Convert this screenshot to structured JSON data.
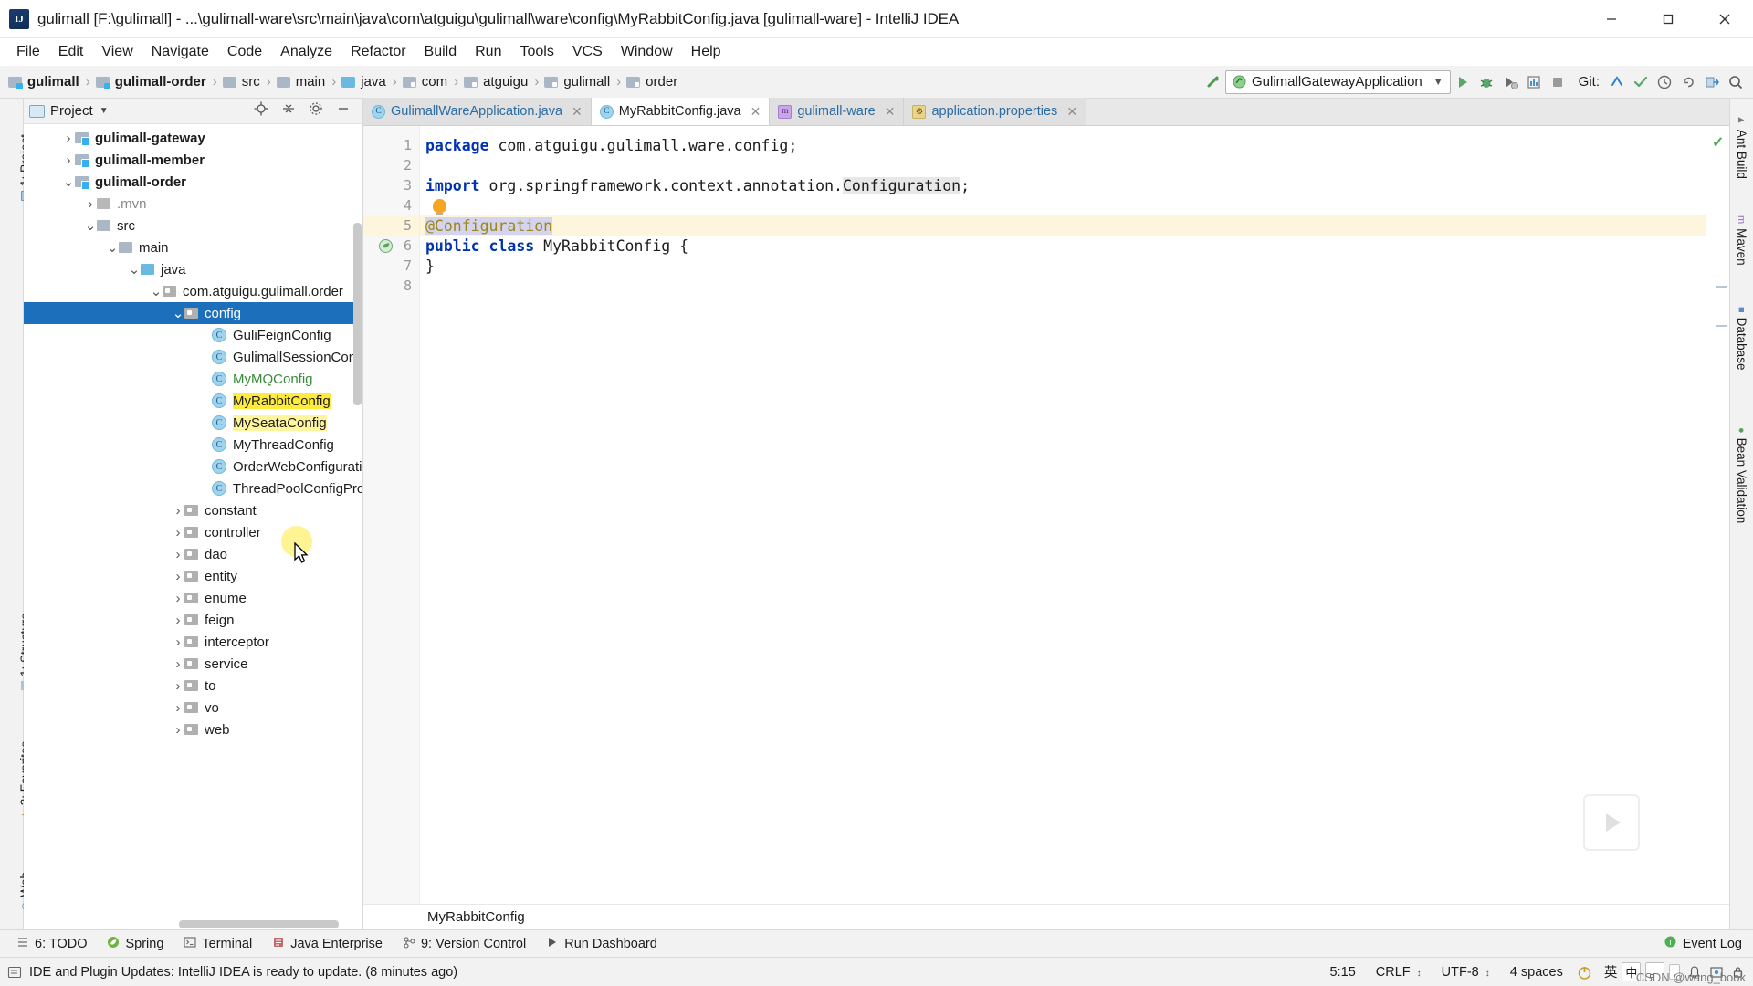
{
  "window": {
    "title": "gulimall [F:\\gulimall] - ...\\gulimall-ware\\src\\main\\java\\com\\atguigu\\gulimall\\ware\\config\\MyRabbitConfig.java [gulimall-ware] - IntelliJ IDEA",
    "logo_text": "IJ",
    "controls": {
      "minimize": "minimize-icon",
      "maximize": "maximize-icon",
      "close": "close-icon"
    }
  },
  "menubar": {
    "items": [
      "File",
      "Edit",
      "View",
      "Navigate",
      "Code",
      "Analyze",
      "Refactor",
      "Build",
      "Run",
      "Tools",
      "VCS",
      "Window",
      "Help"
    ]
  },
  "toolbar": {
    "breadcrumbs": [
      {
        "label": "gulimall",
        "bold": true,
        "icon": "module-folder-icon"
      },
      {
        "label": "gulimall-order",
        "bold": true,
        "icon": "module-folder-icon"
      },
      {
        "label": "src",
        "bold": false,
        "icon": "folder-icon"
      },
      {
        "label": "main",
        "bold": false,
        "icon": "folder-icon"
      },
      {
        "label": "java",
        "bold": false,
        "icon": "source-folder-icon"
      },
      {
        "label": "com",
        "bold": false,
        "icon": "package-icon"
      },
      {
        "label": "atguigu",
        "bold": false,
        "icon": "package-icon"
      },
      {
        "label": "gulimall",
        "bold": false,
        "icon": "package-icon"
      },
      {
        "label": "order",
        "bold": false,
        "icon": "package-icon"
      }
    ],
    "run_configuration": "GulimallGatewayApplication",
    "git_label": "Git:",
    "icons": [
      "build-icon",
      "run-icon",
      "debug-icon",
      "run-coverage-icon",
      "profiler-icon",
      "stop-icon",
      "update-project-icon",
      "commit-icon",
      "history-icon",
      "rollback-icon",
      "select-opened-file-icon",
      "search-everywhere-icon"
    ]
  },
  "left_tool_strip": [
    {
      "label": "1: Project",
      "icon": "project-icon"
    },
    {
      "label": "1: Structure",
      "icon": "structure-icon"
    },
    {
      "label": "2: Favorites",
      "icon": "favorites-icon"
    },
    {
      "label": "Web",
      "icon": "web-icon"
    }
  ],
  "right_tool_strip": [
    {
      "label": "Ant Build",
      "icon": "ant-icon"
    },
    {
      "label": "Maven",
      "icon": "maven-icon"
    },
    {
      "label": "Database",
      "icon": "database-icon"
    },
    {
      "label": "Bean Validation",
      "icon": "bean-validation-icon"
    }
  ],
  "project_panel": {
    "title": "Project",
    "header_icons": [
      "locate-icon",
      "collapse-all-icon",
      "settings-icon",
      "hide-icon"
    ],
    "tree": [
      {
        "depth": 1,
        "arrow": "collapsed",
        "icon": "module-folder-icon",
        "label": "gulimall-gateway",
        "bold": true,
        "selected": false
      },
      {
        "depth": 1,
        "arrow": "collapsed",
        "icon": "module-folder-icon",
        "label": "gulimall-member",
        "bold": true,
        "selected": false
      },
      {
        "depth": 1,
        "arrow": "expanded",
        "icon": "module-folder-icon",
        "label": "gulimall-order",
        "bold": true,
        "selected": false
      },
      {
        "depth": 2,
        "arrow": "collapsed",
        "icon": "folder-icon",
        "label": ".mvn",
        "bold": false,
        "gray": true,
        "selected": false
      },
      {
        "depth": 2,
        "arrow": "expanded",
        "icon": "folder-icon",
        "label": "src",
        "bold": false,
        "selected": false
      },
      {
        "depth": 3,
        "arrow": "expanded",
        "icon": "folder-icon",
        "label": "main",
        "bold": false,
        "selected": false
      },
      {
        "depth": 4,
        "arrow": "expanded",
        "icon": "source-folder-icon",
        "label": "java",
        "bold": false,
        "selected": false
      },
      {
        "depth": 5,
        "arrow": "expanded",
        "icon": "package-icon",
        "label": "com.atguigu.gulimall.order",
        "bold": false,
        "selected": false
      },
      {
        "depth": 6,
        "arrow": "expanded",
        "icon": "package-icon",
        "label": "config",
        "bold": false,
        "selected": true
      },
      {
        "depth": 7,
        "arrow": "none",
        "icon": "class-icon",
        "label": "GuliFeignConfig",
        "bold": false,
        "selected": false
      },
      {
        "depth": 7,
        "arrow": "none",
        "icon": "class-icon",
        "label": "GulimallSessionConfig",
        "bold": false,
        "selected": false
      },
      {
        "depth": 7,
        "arrow": "none",
        "icon": "class-icon",
        "label": "MyMQConfig",
        "bold": false,
        "green": true,
        "selected": false
      },
      {
        "depth": 7,
        "arrow": "none",
        "icon": "class-icon",
        "label": "MyRabbitConfig",
        "bold": false,
        "selected": false,
        "highlight": true
      },
      {
        "depth": 7,
        "arrow": "none",
        "icon": "class-icon",
        "label": "MySeataConfig",
        "bold": false,
        "selected": false,
        "highlight_soft": true
      },
      {
        "depth": 7,
        "arrow": "none",
        "icon": "class-icon",
        "label": "MyThreadConfig",
        "bold": false,
        "selected": false
      },
      {
        "depth": 7,
        "arrow": "none",
        "icon": "class-icon",
        "label": "OrderWebConfiguration",
        "bold": false,
        "selected": false
      },
      {
        "depth": 7,
        "arrow": "none",
        "icon": "class-icon",
        "label": "ThreadPoolConfigProperties",
        "bold": false,
        "selected": false
      },
      {
        "depth": 6,
        "arrow": "collapsed",
        "icon": "package-icon",
        "label": "constant",
        "bold": false,
        "selected": false
      },
      {
        "depth": 6,
        "arrow": "collapsed",
        "icon": "package-icon",
        "label": "controller",
        "bold": false,
        "selected": false
      },
      {
        "depth": 6,
        "arrow": "collapsed",
        "icon": "package-icon",
        "label": "dao",
        "bold": false,
        "selected": false
      },
      {
        "depth": 6,
        "arrow": "collapsed",
        "icon": "package-icon",
        "label": "entity",
        "bold": false,
        "selected": false
      },
      {
        "depth": 6,
        "arrow": "collapsed",
        "icon": "package-icon",
        "label": "enume",
        "bold": false,
        "selected": false
      },
      {
        "depth": 6,
        "arrow": "collapsed",
        "icon": "package-icon",
        "label": "feign",
        "bold": false,
        "selected": false
      },
      {
        "depth": 6,
        "arrow": "collapsed",
        "icon": "package-icon",
        "label": "interceptor",
        "bold": false,
        "selected": false
      },
      {
        "depth": 6,
        "arrow": "collapsed",
        "icon": "package-icon",
        "label": "service",
        "bold": false,
        "selected": false
      },
      {
        "depth": 6,
        "arrow": "collapsed",
        "icon": "package-icon",
        "label": "to",
        "bold": false,
        "selected": false
      },
      {
        "depth": 6,
        "arrow": "collapsed",
        "icon": "package-icon",
        "label": "vo",
        "bold": false,
        "selected": false
      },
      {
        "depth": 6,
        "arrow": "collapsed",
        "icon": "package-icon",
        "label": "web",
        "bold": false,
        "selected": false
      }
    ]
  },
  "editor": {
    "tabs": [
      {
        "label": "GulimallWareApplication.java",
        "icon": "class-icon",
        "active": false,
        "blue": true,
        "closable": true
      },
      {
        "label": "MyRabbitConfig.java",
        "icon": "class-icon",
        "active": true,
        "blue": false,
        "closable": true
      },
      {
        "label": "gulimall-ware",
        "icon": "maven-icon",
        "active": false,
        "blue": true,
        "closable": true
      },
      {
        "label": "application.properties",
        "icon": "properties-icon",
        "active": false,
        "blue": true,
        "closable": true
      }
    ],
    "line_numbers": [
      "1",
      "2",
      "3",
      "4",
      "5",
      "6",
      "7",
      "8"
    ],
    "lines": [
      {
        "n": 1,
        "tokens": [
          {
            "t": "package",
            "c": "kw"
          },
          {
            "t": " com.atguigu.gulimall.ware.config;",
            "c": ""
          }
        ]
      },
      {
        "n": 2,
        "tokens": []
      },
      {
        "n": 3,
        "tokens": [
          {
            "t": "import",
            "c": "kw"
          },
          {
            "t": " org.springframework.context.annotation.",
            "c": ""
          },
          {
            "t": "Configuration",
            "c": "cls-ref"
          },
          {
            "t": ";",
            "c": ""
          }
        ]
      },
      {
        "n": 4,
        "tokens": [
          {
            "t": "",
            "c": "bulb"
          }
        ]
      },
      {
        "n": 5,
        "tokens": [
          {
            "t": "@Configuration",
            "c": "anno-sel"
          }
        ],
        "highlighted": true
      },
      {
        "n": 6,
        "tokens": [
          {
            "t": "public",
            "c": "kw"
          },
          {
            "t": " ",
            "c": ""
          },
          {
            "t": "class",
            "c": "kw"
          },
          {
            "t": " MyRabbitConfig {",
            "c": ""
          }
        ],
        "gutter_icon": "spring-bean-icon"
      },
      {
        "n": 7,
        "tokens": [
          {
            "t": "}",
            "c": ""
          }
        ]
      },
      {
        "n": 8,
        "tokens": []
      }
    ],
    "breadcrumb_bottom": "MyRabbitConfig",
    "inspection_status": "ok-check-icon"
  },
  "bottom_tool_windows": [
    {
      "label": "6: TODO",
      "icon": "todo-icon"
    },
    {
      "label": "Spring",
      "icon": "spring-icon"
    },
    {
      "label": "Terminal",
      "icon": "terminal-icon"
    },
    {
      "label": "Java Enterprise",
      "icon": "java-enterprise-icon"
    },
    {
      "label": "9: Version Control",
      "icon": "version-control-icon"
    },
    {
      "label": "Run Dashboard",
      "icon": "run-dashboard-icon"
    }
  ],
  "event_log": {
    "label": "Event Log",
    "icon": "event-log-icon"
  },
  "statusbar": {
    "message": "IDE and Plugin Updates: IntelliJ IDEA is ready to update. (8 minutes ago)",
    "message_icon": "info-icon",
    "caret_position": "5:15",
    "line_separator": "CRLF",
    "encoding": "UTF-8",
    "indent": "4 spaces",
    "ime": {
      "mode": "英",
      "badges": [
        "中",
        "。",
        ","
      ]
    },
    "icons": [
      "power-save-icon",
      "ime-icon",
      "notification-icon",
      "inspection-icon",
      "lock-icon"
    ]
  },
  "watermark": "CSDN @wang_book",
  "colors": {
    "selection_blue": "#1c6fbb",
    "highlight_yellow": "#ffeb3b",
    "keyword_blue": "#0033b3",
    "annotation_gold": "#9e880d",
    "vcs_green": "#3a8a3a",
    "accent_green": "#4caf50"
  }
}
